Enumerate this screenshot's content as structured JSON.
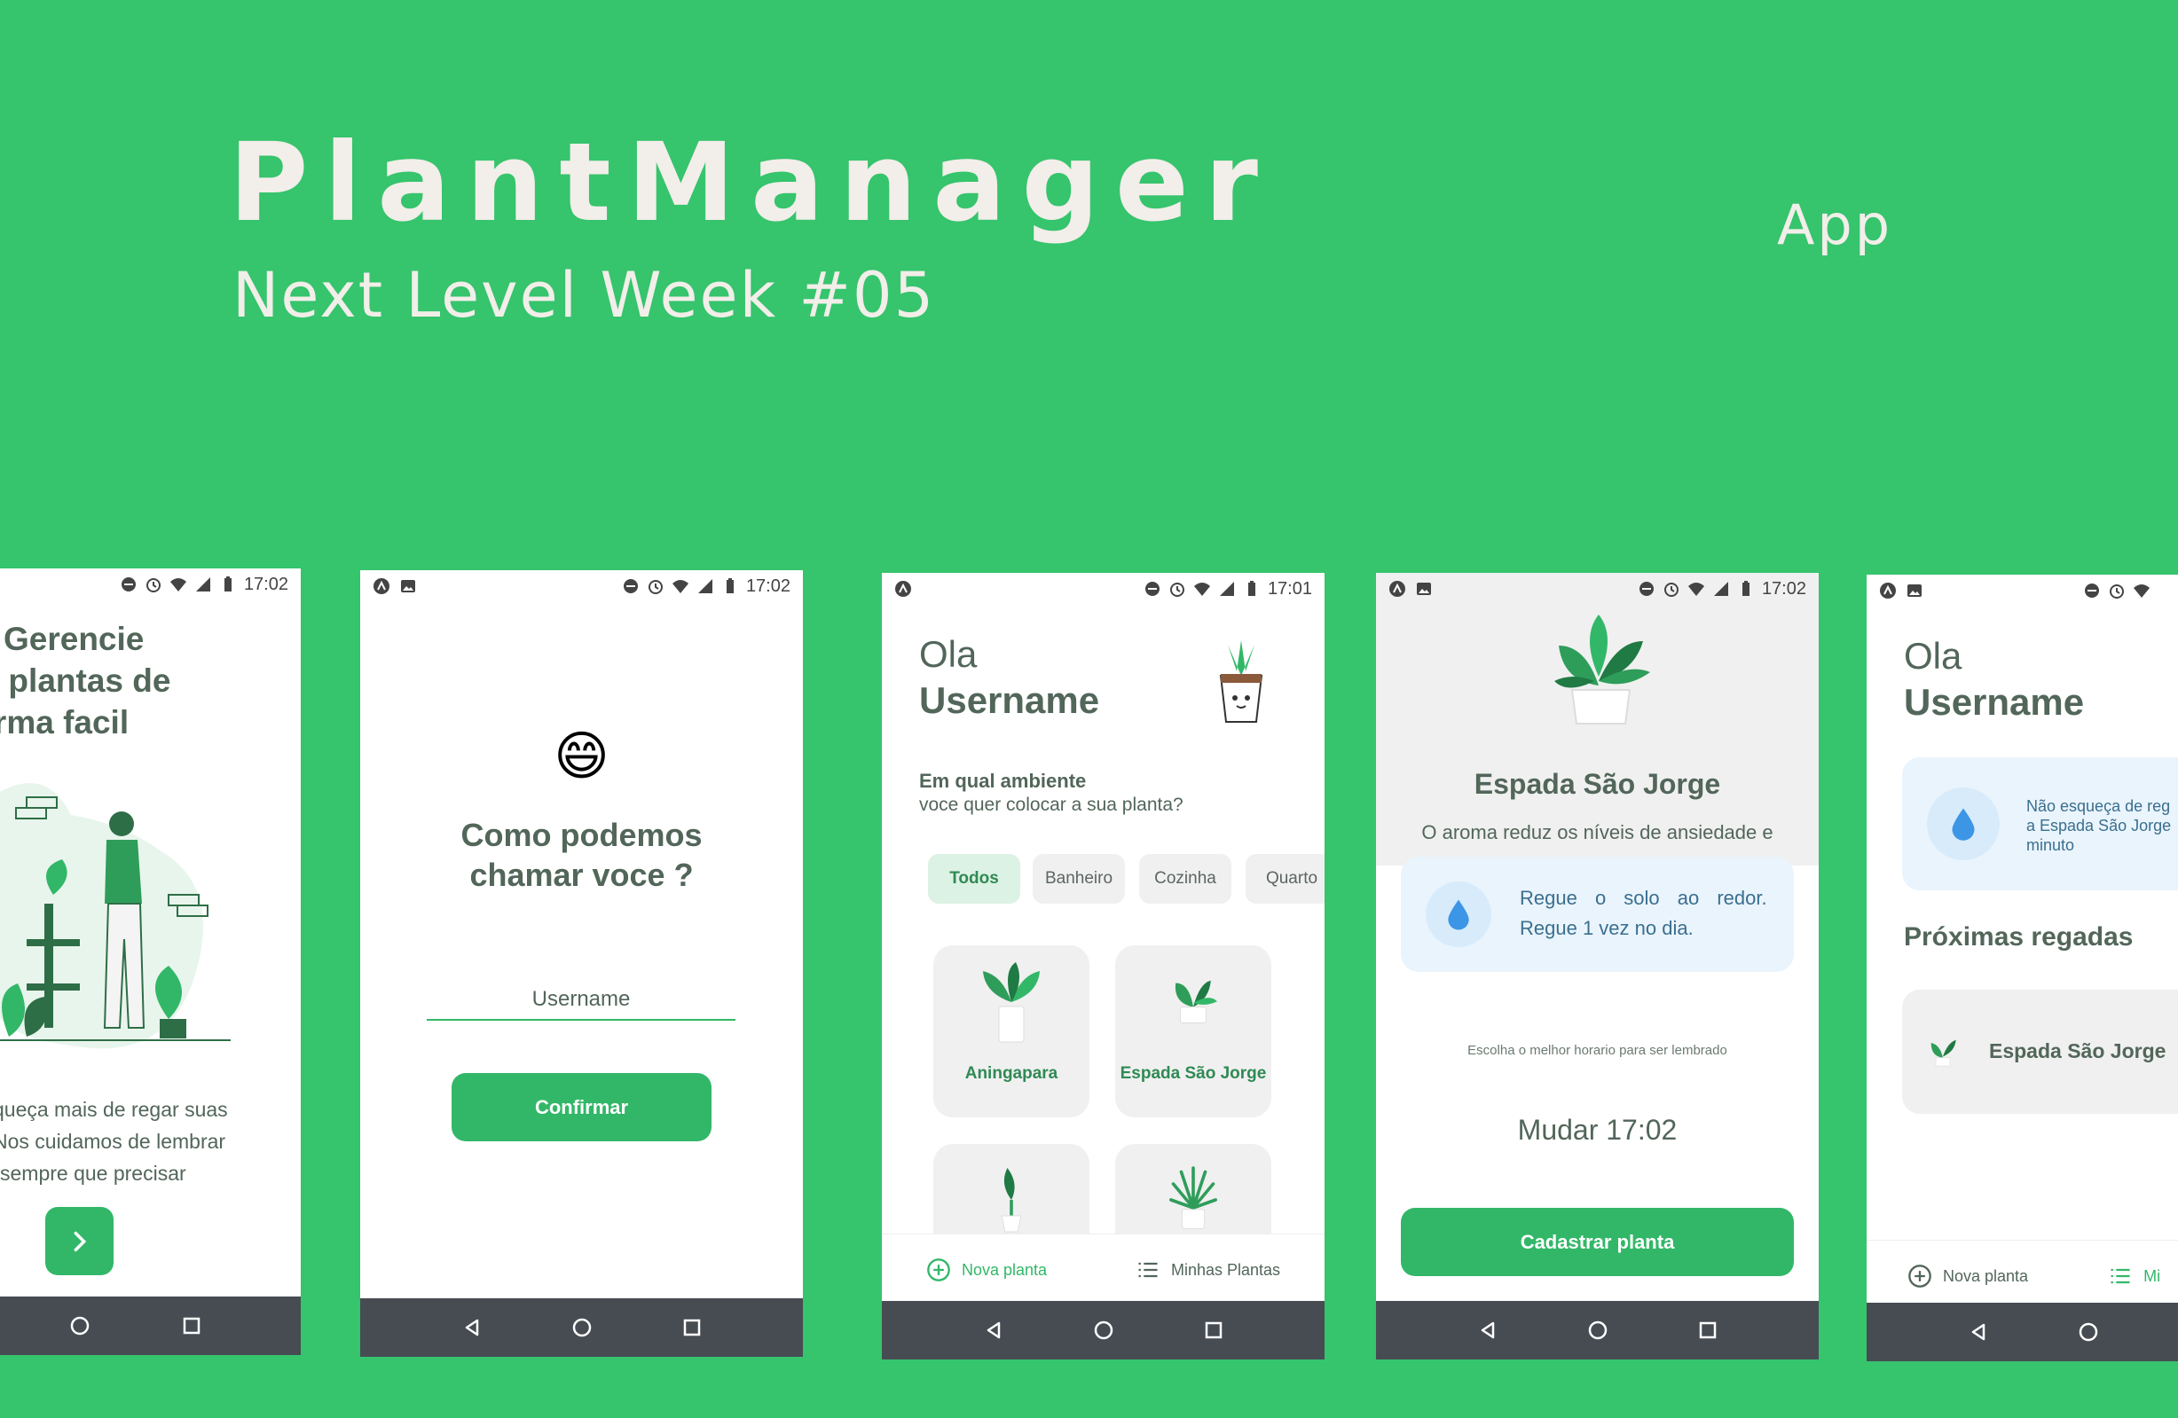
{
  "header": {
    "title": "PlantManager",
    "subtitle": "Next Level Week #05",
    "tag": "App"
  },
  "colors": {
    "background": "#36c46d",
    "green": "#32b768",
    "heading": "#52665a",
    "blue_panel": "#eaf4fc",
    "nav": "#474c53"
  },
  "screen_welcome": {
    "time": "17:02",
    "title": [
      "Gerencie",
      "as plantas de",
      "forma facil"
    ],
    "desc": [
      "queça mais de regar suas",
      "Nos cuidamos de lembrar",
      "sempre que precisar"
    ],
    "next_icon": "chevron-right-icon"
  },
  "screen_name": {
    "time": "17:02",
    "emoji": "😄",
    "title": [
      "Como podemos",
      "chamar voce ?"
    ],
    "input_placeholder": "Username",
    "button": "Confirmar"
  },
  "screen_select": {
    "time": "17:01",
    "greeting": "Ola",
    "username": "Username",
    "question_title": "Em qual ambiente",
    "question_sub": "voce quer colocar a sua planta?",
    "chips": [
      "Todos",
      "Banheiro",
      "Cozinha",
      "Quarto"
    ],
    "plants": [
      "Aningapara",
      "Espada São Jorge"
    ],
    "tab_new": "Nova planta",
    "tab_mine": "Minhas Plantas"
  },
  "screen_plant": {
    "time": "17:02",
    "plant_name": "Espada São Jorge",
    "plant_about": "O aroma reduz os níveis de ansiedade e",
    "tip_line1": "Regue o solo ao redor.",
    "tip_line2": "Regue 1 vez no dia.",
    "alert_label": "Escolha o melhor horario para ser lembrado",
    "change_time": "Mudar 17:02",
    "button": "Cadastrar planta"
  },
  "screen_myplants": {
    "greeting": "Ola",
    "username": "Username",
    "reminder_lines": [
      "Não esqueça de reg",
      "a Espada São Jorge",
      "minuto"
    ],
    "section_title": "Próximas regadas",
    "item_name": "Espada São Jorge",
    "tab_new": "Nova planta",
    "tab_mine": "Mi"
  }
}
